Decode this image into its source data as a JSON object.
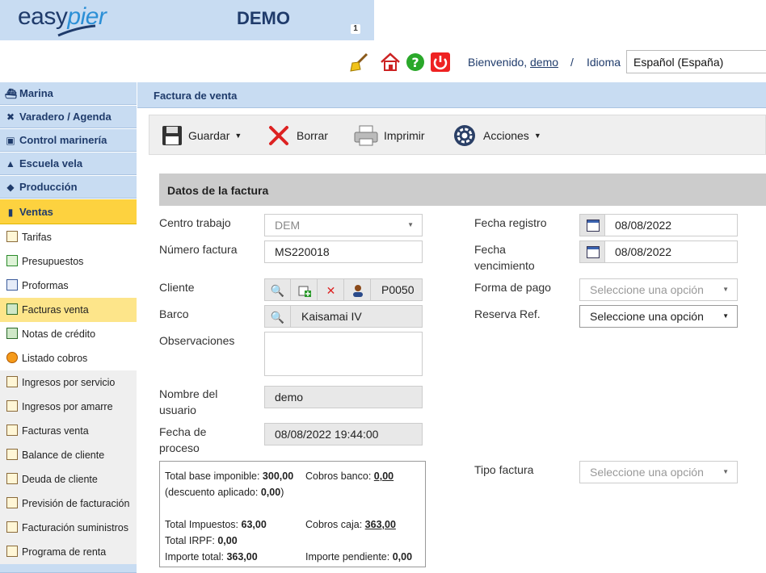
{
  "header": {
    "logo_part1": "easy",
    "logo_part2": "pier",
    "app_name": "DEMO",
    "badge_count": "1",
    "welcome_text": "Bienvenido,",
    "username": "demo",
    "separator": "/",
    "language_label": "Idioma",
    "language_value": "Español (España)",
    "icons": [
      "broom-icon",
      "home-icon",
      "help-icon",
      "power-icon"
    ]
  },
  "sidebar": {
    "sections": [
      {
        "icon": "boat-icon",
        "label": "Marina"
      },
      {
        "icon": "tools-icon",
        "label": "Varadero / Agenda"
      },
      {
        "icon": "clipboard-icon",
        "label": "Control marinería"
      },
      {
        "icon": "graduation-cap-icon",
        "label": "Escuela vela"
      },
      {
        "icon": "tag-icon",
        "label": "Producción"
      },
      {
        "icon": "document-icon",
        "label": "Ventas"
      }
    ],
    "ventas_items": [
      {
        "label": "Tarifas"
      },
      {
        "label": "Presupuestos"
      },
      {
        "label": "Proformas"
      },
      {
        "label": "Facturas venta"
      },
      {
        "label": "Notas de crédito"
      },
      {
        "label": "Listado cobros"
      }
    ],
    "report_items": [
      {
        "label": "Ingresos por servicio"
      },
      {
        "label": "Ingresos por amarre"
      },
      {
        "label": "Facturas venta"
      },
      {
        "label": "Balance de cliente"
      },
      {
        "label": "Deuda de cliente"
      },
      {
        "label": "Previsión de facturación"
      },
      {
        "label": "Facturación suministros"
      },
      {
        "label": "Programa de renta"
      }
    ]
  },
  "page": {
    "title": "Factura de venta"
  },
  "toolbar": {
    "save": "Guardar",
    "delete": "Borrar",
    "print": "Imprimir",
    "actions": "Acciones"
  },
  "form": {
    "section_title": "Datos de la factura",
    "centro_label": "Centro trabajo",
    "centro_value": "DEM",
    "numero_label": "Número factura",
    "numero_value": "MS220018",
    "cliente_label": "Cliente",
    "cliente_value": "P0050",
    "barco_label": "Barco",
    "barco_value": "Kaisamai IV",
    "observaciones_label": "Observaciones",
    "observaciones_value": "",
    "usuario_label_1": "Nombre del",
    "usuario_label_2": "usuario",
    "usuario_value": "demo",
    "proceso_label_1": "Fecha de",
    "proceso_label_2": "proceso",
    "proceso_value": "08/08/2022 19:44:00",
    "fecha_registro_label": "Fecha registro",
    "fecha_registro_value": "08/08/2022",
    "fecha_venc_label_1": "Fecha",
    "fecha_venc_label_2": "vencimiento",
    "fecha_venc_value": "08/08/2022",
    "forma_pago_label": "Forma de pago",
    "forma_pago_placeholder": "Seleccione una opción",
    "reserva_label": "Reserva Ref.",
    "reserva_placeholder": "Seleccione una opción",
    "tipo_factura_label": "Tipo factura",
    "tipo_factura_placeholder": "Seleccione una opción"
  },
  "totals": {
    "base_label": "Total base imponible:",
    "base_value": "300,00",
    "descuento_label": "(descuento aplicado:",
    "descuento_value": "0,00",
    "descuento_close": ")",
    "impuestos_label": "Total Impuestos:",
    "impuestos_value": "63,00",
    "irpf_label": "Total IRPF:",
    "irpf_value": "0,00",
    "importe_label": "Importe total:",
    "importe_value": "363,00",
    "cobros_banco_label": "Cobros banco:",
    "cobros_banco_value": "0,00",
    "cobros_caja_label": "Cobros caja:",
    "cobros_caja_value": "363,00",
    "pendiente_label": "Importe pendiente:",
    "pendiente_value": "0,00"
  },
  "colors": {
    "header_blue": "#c8dcf2",
    "active_yellow": "#fdd23f",
    "selected_item": "#fde58a",
    "navy_text": "#1f3b6b"
  }
}
